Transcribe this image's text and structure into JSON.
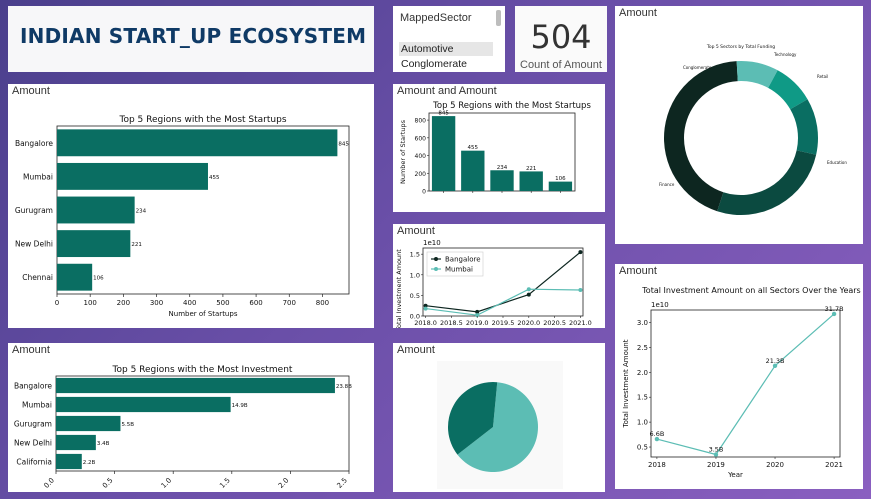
{
  "header": {
    "title": "INDIAN START_UP ECOSYSTEM"
  },
  "slicer": {
    "title": "MappedSector",
    "items": [
      "Automotive",
      "Conglomerate"
    ]
  },
  "kpi": {
    "value": "504",
    "label": "Count of Amount"
  },
  "cards": {
    "reg_bar": "Amount",
    "amt_bar": "Amount and Amount",
    "line": "Amount",
    "inv_bar": "Amount",
    "pie": "Amount",
    "donut": "Amount",
    "total": "Amount"
  },
  "colors": {
    "teal_dark": "#0a6e62",
    "teal_light": "#5cbdb4",
    "navy": "#0f3a66",
    "near_black": "#0d2620"
  },
  "chart_data": [
    {
      "id": "regions_startups_h",
      "type": "bar",
      "orientation": "horizontal",
      "title": "Top 5 Regions with the Most Startups",
      "xlabel": "Number of Startups",
      "categories": [
        "Bangalore",
        "Mumbai",
        "Gurugram",
        "New Delhi",
        "Chennai"
      ],
      "values": [
        845,
        455,
        234,
        221,
        106
      ],
      "data_labels": [
        "845",
        "455",
        "234",
        "221",
        "106"
      ],
      "xlim": [
        0,
        880
      ],
      "xticks": [
        0,
        100,
        200,
        300,
        400,
        500,
        600,
        700,
        800
      ],
      "xtick_labels": [
        "0",
        "100",
        "200",
        "300",
        "400",
        "500",
        "600",
        "700",
        "800"
      ]
    },
    {
      "id": "regions_startups_v",
      "type": "bar",
      "title": "Top 5 Regions with the Most Startups",
      "ylabel": "Number of Startups",
      "categories": [
        "Bangalore",
        "Mumbai",
        "Gurugram",
        "New Delhi",
        "Chennai"
      ],
      "values": [
        845,
        455,
        234,
        221,
        106
      ],
      "data_labels": [
        "845",
        "455",
        "234",
        "221",
        "106"
      ],
      "ylim": [
        0,
        880
      ],
      "yticks": [
        0,
        200,
        400,
        600,
        800
      ],
      "ytick_labels": [
        "0",
        "200",
        "400",
        "600",
        "800"
      ]
    },
    {
      "id": "investment_line",
      "type": "line",
      "ylabel": "Total Investment Amount",
      "offset_label": "1e10",
      "x": [
        2018,
        2019,
        2020,
        2021
      ],
      "series": [
        {
          "name": "Bangalore",
          "values": [
            0.25,
            0.1,
            0.52,
            1.55
          ]
        },
        {
          "name": "Mumbai",
          "values": [
            0.18,
            0.02,
            0.65,
            0.63
          ]
        }
      ],
      "xlim": [
        2017.95,
        2021.05
      ],
      "ylim": [
        0,
        1.65
      ],
      "yticks": [
        0.0,
        0.5,
        1.0,
        1.5
      ],
      "ytick_labels": [
        "0.0",
        "0.5",
        "1.0",
        "1.5"
      ],
      "xticks": [
        2018,
        2018.5,
        2019,
        2019.5,
        2020,
        2020.5,
        2021
      ],
      "xtick_labels": [
        "2018.0",
        "2018.5",
        "2019.0",
        "2019.5",
        "2020.0",
        "2020.5",
        "2021.0"
      ],
      "legend": "upper-left"
    },
    {
      "id": "regions_investment_h",
      "type": "bar",
      "orientation": "horizontal",
      "title": "Top 5 Regions with the Most Investment",
      "categories": [
        "Bangalore",
        "Mumbai",
        "Gurugram",
        "New Delhi",
        "California"
      ],
      "values": [
        23.8,
        14.9,
        5.5,
        3.4,
        2.2
      ],
      "data_labels": [
        "23.8B",
        "14.9B",
        "5.5B",
        "3.4B",
        "2.2B"
      ],
      "xlim": [
        0,
        25
      ],
      "xticks": [
        0,
        5,
        10,
        15,
        20,
        25
      ],
      "xtick_labels": [
        "0.0",
        "0.5",
        "1.0",
        "1.5",
        "2.0",
        "2.5"
      ]
    },
    {
      "id": "sector_pie",
      "type": "pie",
      "values": [
        63,
        37
      ],
      "colors": [
        "#5cbdb4",
        "#0a6e62"
      ]
    },
    {
      "id": "sector_donut",
      "type": "pie",
      "title": "Top 5 Sectors by Total Funding",
      "categories": [
        "Finance",
        "Conglomerate",
        "Technology",
        "Retail",
        "Education"
      ],
      "values": [
        44.1,
        8.8,
        8.7,
        11.9,
        26.5
      ],
      "colors": [
        "#0d2620",
        "#5cbdb4",
        "#0f9a86",
        "#0a6e62",
        "#0b4a40"
      ]
    },
    {
      "id": "total_investment_line",
      "type": "line",
      "title": "Total Investment Amount on all Sectors Over the Years",
      "xlabel": "Year",
      "ylabel": "Total Investment Amount",
      "offset_label": "1e10",
      "x": [
        2018,
        2019,
        2020,
        2021
      ],
      "series": [
        {
          "values": [
            0.66,
            0.35,
            2.13,
            3.17
          ]
        }
      ],
      "data_labels": [
        "6.6B",
        "3.5B",
        "21.3B",
        "31.7B"
      ],
      "xlim": [
        2017.9,
        2021.1
      ],
      "ylim": [
        0.3,
        3.25
      ],
      "yticks": [
        0.5,
        1.0,
        1.5,
        2.0,
        2.5,
        3.0
      ],
      "ytick_labels": [
        "0.5",
        "1.0",
        "1.5",
        "2.0",
        "2.5",
        "3.0"
      ],
      "xticks": [
        2018,
        2019,
        2020,
        2021
      ],
      "xtick_labels": [
        "2018",
        "2019",
        "2020",
        "2021"
      ]
    }
  ]
}
